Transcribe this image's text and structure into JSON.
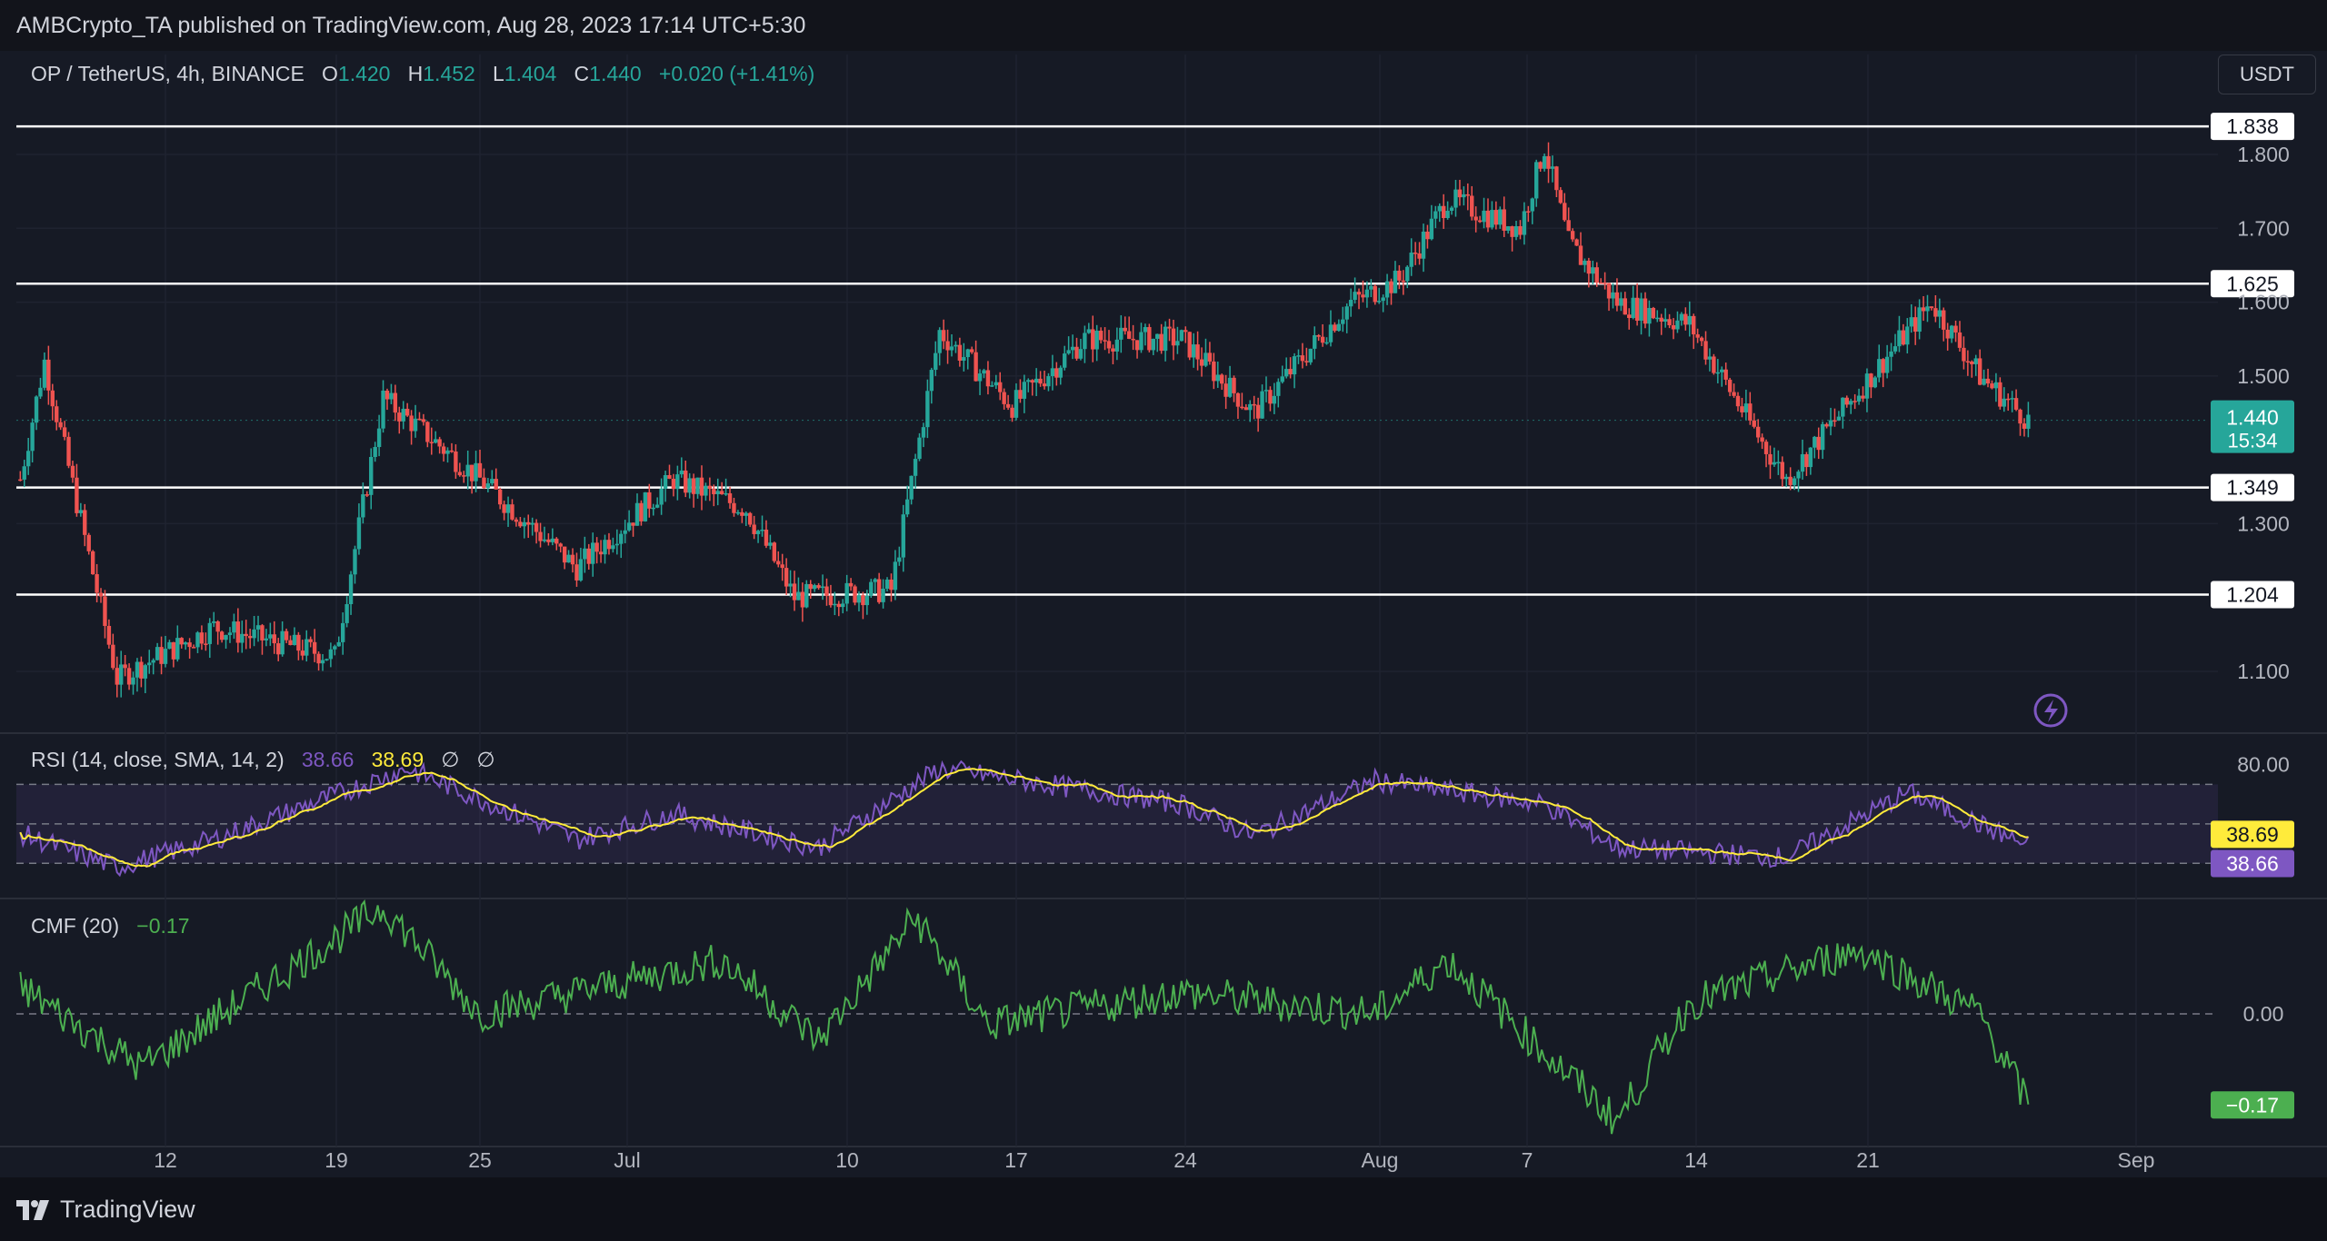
{
  "publisher": "AMBCrypto_TA published on TradingView.com, Aug 28, 2023 17:14 UTC+5:30",
  "currency_button": "USDT",
  "logo_text": "TradingView",
  "legend": {
    "symbol": "OP / TetherUS, 4h, BINANCE",
    "o_label": "O",
    "o_value": "1.420",
    "h_label": "H",
    "h_value": "1.452",
    "l_label": "L",
    "l_value": "1.404",
    "c_label": "C",
    "c_value": "1.440",
    "change": "+0.020 (+1.41%)"
  },
  "rsi_legend": {
    "label": "RSI (14, close, SMA, 14, 2)",
    "rsi": "38.66",
    "sma": "38.69",
    "extra1": "∅",
    "extra2": "∅"
  },
  "cmf_legend": {
    "label": "CMF (20)",
    "value": "−0.17"
  },
  "price_badge": {
    "value": "1.440",
    "countdown": "15:34"
  },
  "colors": {
    "up": "#26a69a",
    "down": "#ef5350",
    "rsi": "#7e57c2",
    "rsi_sma": "#ffeb3b",
    "cmf": "#4caf50",
    "background": "#161a25"
  },
  "chart_data": {
    "type": "candlestick",
    "x_ticks": [
      "12",
      "19",
      "25",
      "Jul",
      "10",
      "17",
      "24",
      "Aug",
      "7",
      "14",
      "21",
      "Sep"
    ],
    "y_ticks": [
      "1.100",
      "1.300",
      "1.500",
      "1.600",
      "1.700",
      "1.800"
    ],
    "y_range": [
      1.02,
      1.88
    ],
    "horizontal_levels": [
      "1.838",
      "1.625",
      "1.349",
      "1.204"
    ],
    "key_points": [
      {
        "date": "Jun 6",
        "close": 1.36
      },
      {
        "date": "Jun 7",
        "close": 1.52
      },
      {
        "date": "Jun 10",
        "close": 1.09
      },
      {
        "date": "Jun 14",
        "close": 1.16
      },
      {
        "date": "Jun 19",
        "close": 1.12
      },
      {
        "date": "Jun 21",
        "close": 1.47
      },
      {
        "date": "Jun 25",
        "close": 1.36
      },
      {
        "date": "Jun 29",
        "close": 1.24
      },
      {
        "date": "Jul 3",
        "close": 1.36
      },
      {
        "date": "Jul 6",
        "close": 1.32
      },
      {
        "date": "Jul 8",
        "close": 1.2
      },
      {
        "date": "Jul 12",
        "close": 1.21
      },
      {
        "date": "Jul 14",
        "close": 1.56
      },
      {
        "date": "Jul 17",
        "close": 1.46
      },
      {
        "date": "Jul 20",
        "close": 1.55
      },
      {
        "date": "Jul 24",
        "close": 1.55
      },
      {
        "date": "Jul 27",
        "close": 1.45
      },
      {
        "date": "Jul 31",
        "close": 1.6
      },
      {
        "date": "Aug 2",
        "close": 1.63
      },
      {
        "date": "Aug 4",
        "close": 1.74
      },
      {
        "date": "Aug 7",
        "close": 1.7
      },
      {
        "date": "Aug 8",
        "close": 1.81
      },
      {
        "date": "Aug 9",
        "close": 1.68
      },
      {
        "date": "Aug 11",
        "close": 1.6
      },
      {
        "date": "Aug 14",
        "close": 1.57
      },
      {
        "date": "Aug 17",
        "close": 1.41
      },
      {
        "date": "Aug 18",
        "close": 1.36
      },
      {
        "date": "Aug 21",
        "close": 1.48
      },
      {
        "date": "Aug 24",
        "close": 1.6
      },
      {
        "date": "Aug 26",
        "close": 1.5
      },
      {
        "date": "Aug 28",
        "close": 1.44
      }
    ],
    "rsi": {
      "levels": [
        "80.00"
      ],
      "last_rsi": 38.66,
      "last_sma": 38.69,
      "key_points": [
        {
          "date": "Jun 6",
          "rsi": 45
        },
        {
          "date": "Jun 10",
          "rsi": 28
        },
        {
          "date": "Jun 14",
          "rsi": 42
        },
        {
          "date": "Jun 22",
          "rsi": 78
        },
        {
          "date": "Jun 29",
          "rsi": 42
        },
        {
          "date": "Jul 3",
          "rsi": 55
        },
        {
          "date": "Jul 9",
          "rsi": 38
        },
        {
          "date": "Jul 14",
          "rsi": 78
        },
        {
          "date": "Jul 24",
          "rsi": 60
        },
        {
          "date": "Jul 27",
          "rsi": 44
        },
        {
          "date": "Aug 1",
          "rsi": 72
        },
        {
          "date": "Aug 8",
          "rsi": 60
        },
        {
          "date": "Aug 11",
          "rsi": 38
        },
        {
          "date": "Aug 18",
          "rsi": 33
        },
        {
          "date": "Aug 23",
          "rsi": 66
        },
        {
          "date": "Aug 28",
          "rsi": 38.66
        }
      ]
    },
    "cmf": {
      "zero_label": "0.00",
      "last": -0.17,
      "key_points": [
        {
          "date": "Jun 6",
          "cmf": 0.05
        },
        {
          "date": "Jun 11",
          "cmf": -0.1
        },
        {
          "date": "Jun 21",
          "cmf": 0.2
        },
        {
          "date": "Jun 25",
          "cmf": 0.0
        },
        {
          "date": "Jul 5",
          "cmf": 0.1
        },
        {
          "date": "Jul 9",
          "cmf": -0.05
        },
        {
          "date": "Jul 13",
          "cmf": 0.18
        },
        {
          "date": "Jul 16",
          "cmf": -0.02
        },
        {
          "date": "Jul 24",
          "cmf": 0.04
        },
        {
          "date": "Aug 1",
          "cmf": 0.0
        },
        {
          "date": "Aug 4",
          "cmf": 0.1
        },
        {
          "date": "Aug 11",
          "cmf": -0.2
        },
        {
          "date": "Aug 14",
          "cmf": 0.02
        },
        {
          "date": "Aug 21",
          "cmf": 0.12
        },
        {
          "date": "Aug 26",
          "cmf": 0.0
        },
        {
          "date": "Aug 28",
          "cmf": -0.17
        }
      ]
    }
  }
}
